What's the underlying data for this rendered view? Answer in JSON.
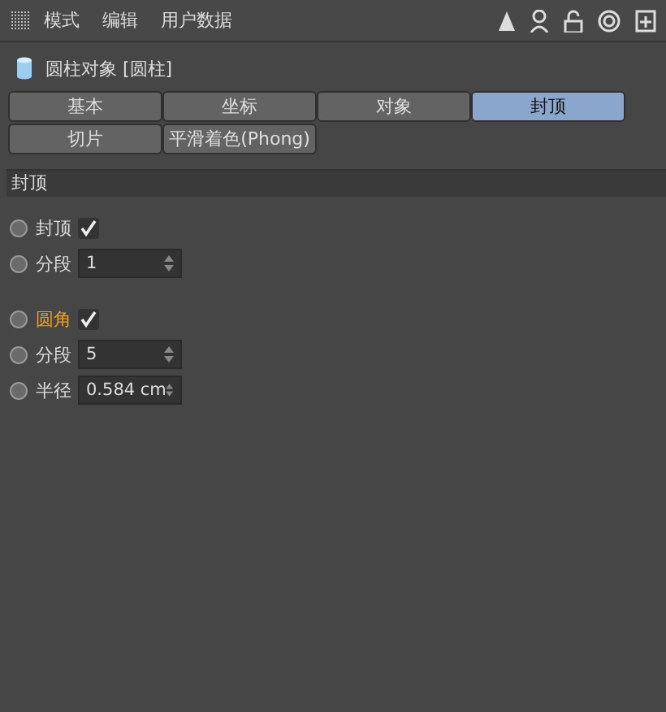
{
  "menu": [
    "模式",
    "编辑",
    "用户数据"
  ],
  "object_title": "圆柱对象 [圆柱]",
  "tabs": [
    {
      "label": "基本",
      "selected": false
    },
    {
      "label": "坐标",
      "selected": false
    },
    {
      "label": "对象",
      "selected": false
    },
    {
      "label": "封顶",
      "selected": true
    },
    {
      "label": "切片",
      "selected": false
    },
    {
      "label": "平滑着色(Phong)",
      "selected": false
    }
  ],
  "section": "封顶",
  "groups": [
    [
      {
        "kind": "checkbox",
        "label": "封顶",
        "highlighted": false,
        "keyframed": false,
        "checked": true
      },
      {
        "kind": "number",
        "label": "分段",
        "highlighted": false,
        "keyframed": false,
        "value": "1"
      }
    ],
    [
      {
        "kind": "checkbox",
        "label": "圆角",
        "highlighted": true,
        "keyframed": false,
        "checked": true
      },
      {
        "kind": "number",
        "label": "分段",
        "highlighted": false,
        "keyframed": false,
        "value": "5"
      },
      {
        "kind": "number",
        "label": "半径",
        "highlighted": false,
        "keyframed": false,
        "value": "0.584 cm"
      }
    ]
  ]
}
